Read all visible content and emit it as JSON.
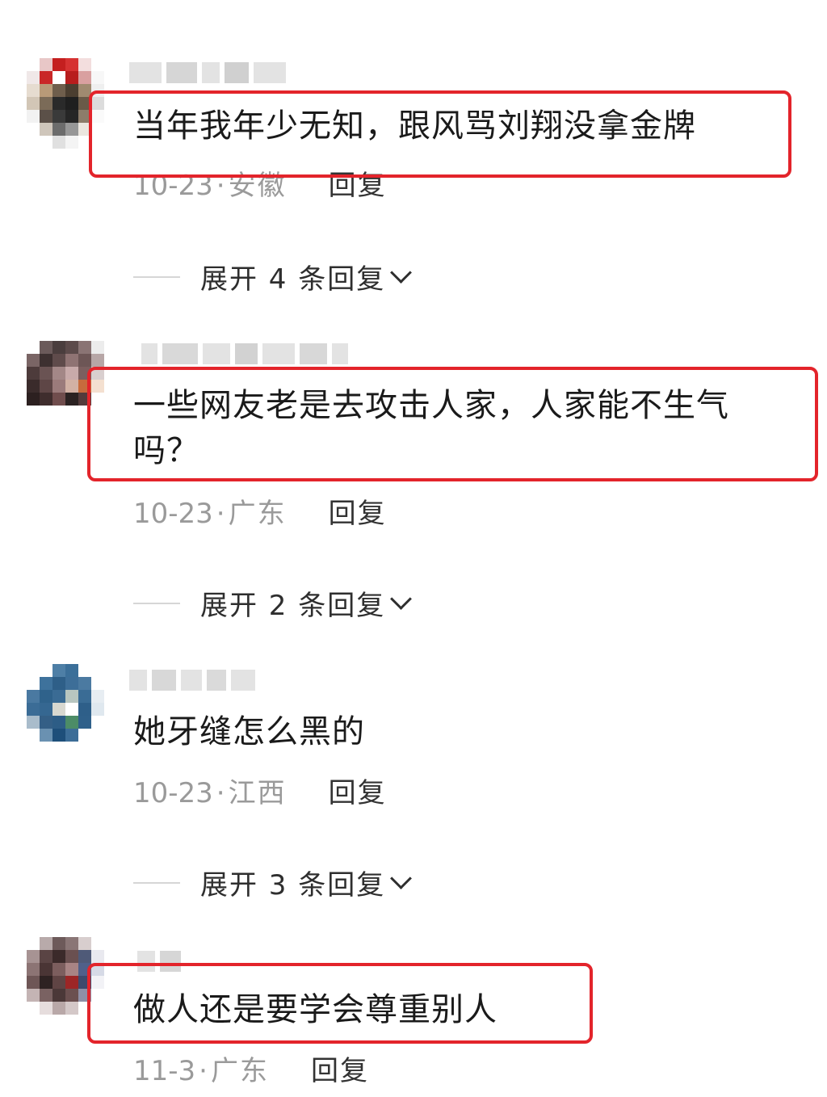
{
  "comments": [
    {
      "text": "当年我年少无知，跟风骂刘翔没拿金牌",
      "date": "10-23",
      "region": "安徽",
      "reply_label": "回复",
      "expand_label": "展开 4 条回复"
    },
    {
      "text": "一些网友老是去攻击人家，人家能不生气\n吗？",
      "date": "10-23",
      "region": "广东",
      "reply_label": "回复",
      "expand_label": "展开 2 条回复"
    },
    {
      "text": "她牙缝怎么黑的",
      "date": "10-23",
      "region": "江西",
      "reply_label": "回复",
      "expand_label": "展开 3 条回复"
    },
    {
      "text": "做人还是要学会尊重别人",
      "date": "11-3",
      "region": "广东",
      "reply_label": "回复"
    }
  ],
  "colors": {
    "highlight": "#e3242b",
    "meta_text": "#9a9a9a",
    "body_text": "#1a1a1a"
  },
  "icons": {
    "expand": "chevron-down-icon"
  }
}
